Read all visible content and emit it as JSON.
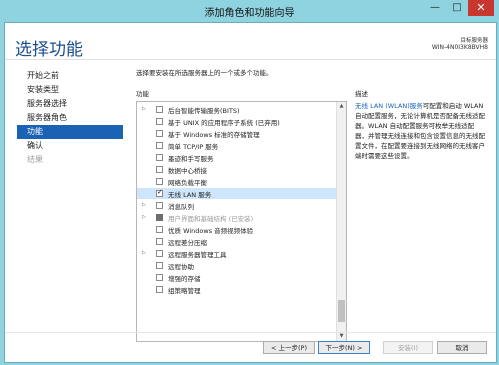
{
  "window": {
    "title": "添加角色和功能向导",
    "minimize": "—",
    "maximize": "□",
    "close": "✕"
  },
  "header": {
    "title": "选择功能",
    "server_label": "目标服务器",
    "server_name": "WIN-4N0I3K8BVH8"
  },
  "nav": {
    "items": [
      {
        "label": "开始之前",
        "state": "normal"
      },
      {
        "label": "安装类型",
        "state": "normal"
      },
      {
        "label": "服务器选择",
        "state": "normal"
      },
      {
        "label": "服务器角色",
        "state": "normal"
      },
      {
        "label": "功能",
        "state": "active"
      },
      {
        "label": "确认",
        "state": "normal"
      },
      {
        "label": "结果",
        "state": "disabled"
      }
    ]
  },
  "main": {
    "instruction": "选择要安装在所选服务器上的一个或多个功能。",
    "features_label": "功能",
    "description_label": "描述",
    "features": [
      {
        "label": "后台智能传输服务(BITS)",
        "expandable": true,
        "checked": false
      },
      {
        "label": "基于 UNIX 的应用程序子系统 (已弃用)",
        "expandable": false,
        "checked": false
      },
      {
        "label": "基于 Windows 标准的存储管理",
        "expandable": false,
        "checked": false
      },
      {
        "label": "简单 TCP/IP 服务",
        "expandable": false,
        "checked": false
      },
      {
        "label": "墨迹和手写服务",
        "expandable": false,
        "checked": false
      },
      {
        "label": "数据中心桥接",
        "expandable": false,
        "checked": false
      },
      {
        "label": "网络负载平衡",
        "expandable": false,
        "checked": false
      },
      {
        "label": "无线 LAN 服务",
        "expandable": false,
        "checked": true,
        "selected": true
      },
      {
        "label": "消息队列",
        "expandable": true,
        "checked": false
      },
      {
        "label": "用户界面和基础结构 (已安装)",
        "expandable": true,
        "checked": "partial",
        "disabled": true
      },
      {
        "label": "优质 Windows 音频视频体验",
        "expandable": false,
        "checked": false
      },
      {
        "label": "远程差分压缩",
        "expandable": false,
        "checked": false
      },
      {
        "label": "远程服务器管理工具",
        "expandable": true,
        "checked": false
      },
      {
        "label": "远程协助",
        "expandable": false,
        "checked": false
      },
      {
        "label": "增强的存储",
        "expandable": false,
        "checked": false
      },
      {
        "label": "组策略管理",
        "expandable": false,
        "checked": false
      }
    ],
    "description": {
      "link": "无线 LAN (WLAN)服务",
      "text": "可配置和启动 WLAN 自动配置服务，无论计算机是否配备无线适配器。WLAN 自动配置服务可枚举无线适配器，并管理无线连接和包含设置信息的无线配置文件，在配置要连接到无线网络的无线客户端时需要这些设置。"
    }
  },
  "footer": {
    "previous": "< 上一步(P)",
    "next": "下一步(N) >",
    "install": "安装(I)",
    "cancel": "取消"
  }
}
